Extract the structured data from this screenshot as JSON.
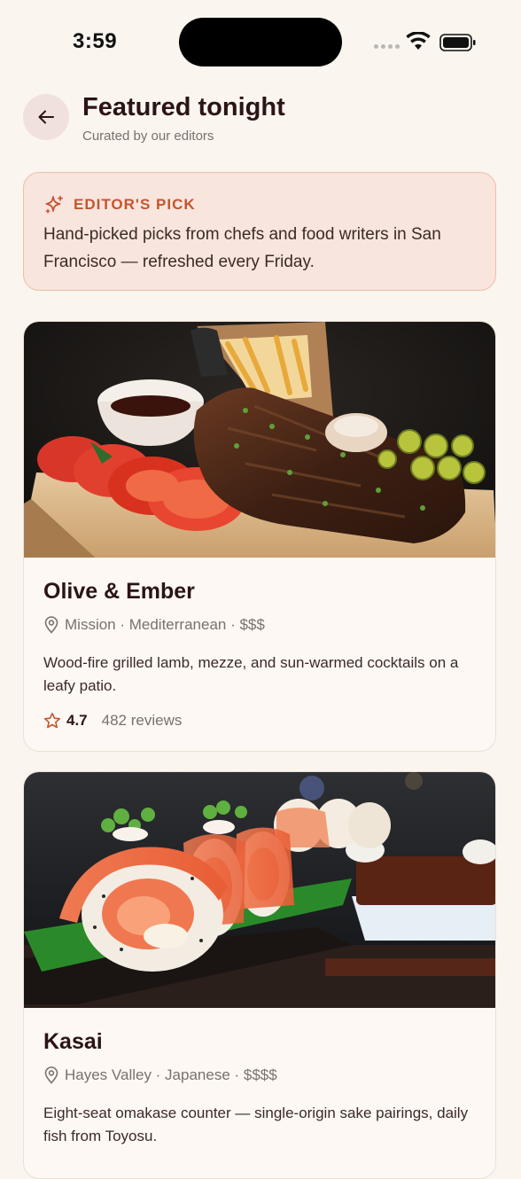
{
  "status_bar": {
    "time": "3:59"
  },
  "header": {
    "title": "Featured tonight",
    "subtitle": "Curated by our editors"
  },
  "banner": {
    "label": "EDITOR'S PICK",
    "text": "Hand-picked picks from chefs and food writers in San Francisco — refreshed every Friday."
  },
  "restaurants": [
    {
      "name": "Olive & Ember",
      "meta": "Mission · Mediterranean · $$$",
      "description": "Wood-fire grilled lamb, mezze, and sun-warmed cocktails on a leafy patio.",
      "rating": "4.7",
      "reviews": "482 reviews"
    },
    {
      "name": "Kasai",
      "meta": "Hayes Valley · Japanese · $$$$",
      "description": "Eight-seat omakase counter — single-origin sake pairings, daily fish from Toyosu."
    }
  ],
  "colors": {
    "background": "#faf5ef",
    "accent": "#c4552f",
    "banner_bg": "#f8e5dd",
    "banner_border": "#ecbfa9",
    "title": "#2b1414",
    "muted": "#7a706c"
  },
  "icons": {
    "back": "arrow-left-icon",
    "banner": "sparkle-icon",
    "location": "map-pin-icon",
    "rating": "star-icon"
  }
}
